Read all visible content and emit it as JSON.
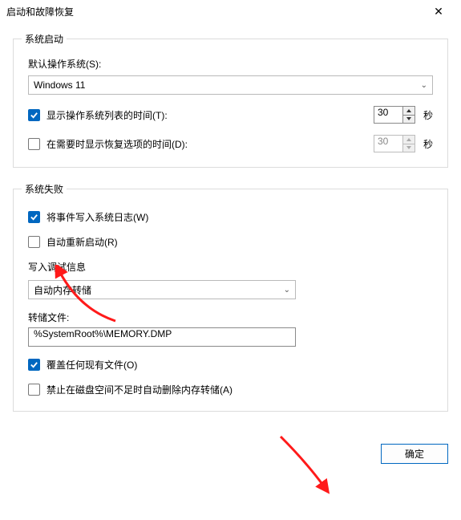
{
  "title": "启动和故障恢复",
  "close": "✕",
  "group1": {
    "legend": "系统启动",
    "defaultOSLabel": "默认操作系统(S):",
    "defaultOSValue": "Windows 11",
    "showOSList": {
      "label": "显示操作系统列表的时间(T):",
      "value": "30",
      "unit": "秒",
      "checked": true
    },
    "showRecovery": {
      "label": "在需要时显示恢复选项的时间(D):",
      "value": "30",
      "unit": "秒",
      "checked": false
    }
  },
  "group2": {
    "legend": "系统失败",
    "writeLog": {
      "label": "将事件写入系统日志(W)",
      "checked": true
    },
    "autoRestart": {
      "label": "自动重新启动(R)",
      "checked": false
    },
    "debugHeading": "写入调试信息",
    "debugSelect": "自动内存转储",
    "dumpFileLabel": "转储文件:",
    "dumpFileValue": "%SystemRoot%\\MEMORY.DMP",
    "overwrite": {
      "label": "覆盖任何现有文件(O)",
      "checked": true
    },
    "disableAutoDelete": {
      "label": "禁止在磁盘空间不足时自动删除内存转储(A)",
      "checked": false
    }
  },
  "buttons": {
    "ok": "确定"
  }
}
